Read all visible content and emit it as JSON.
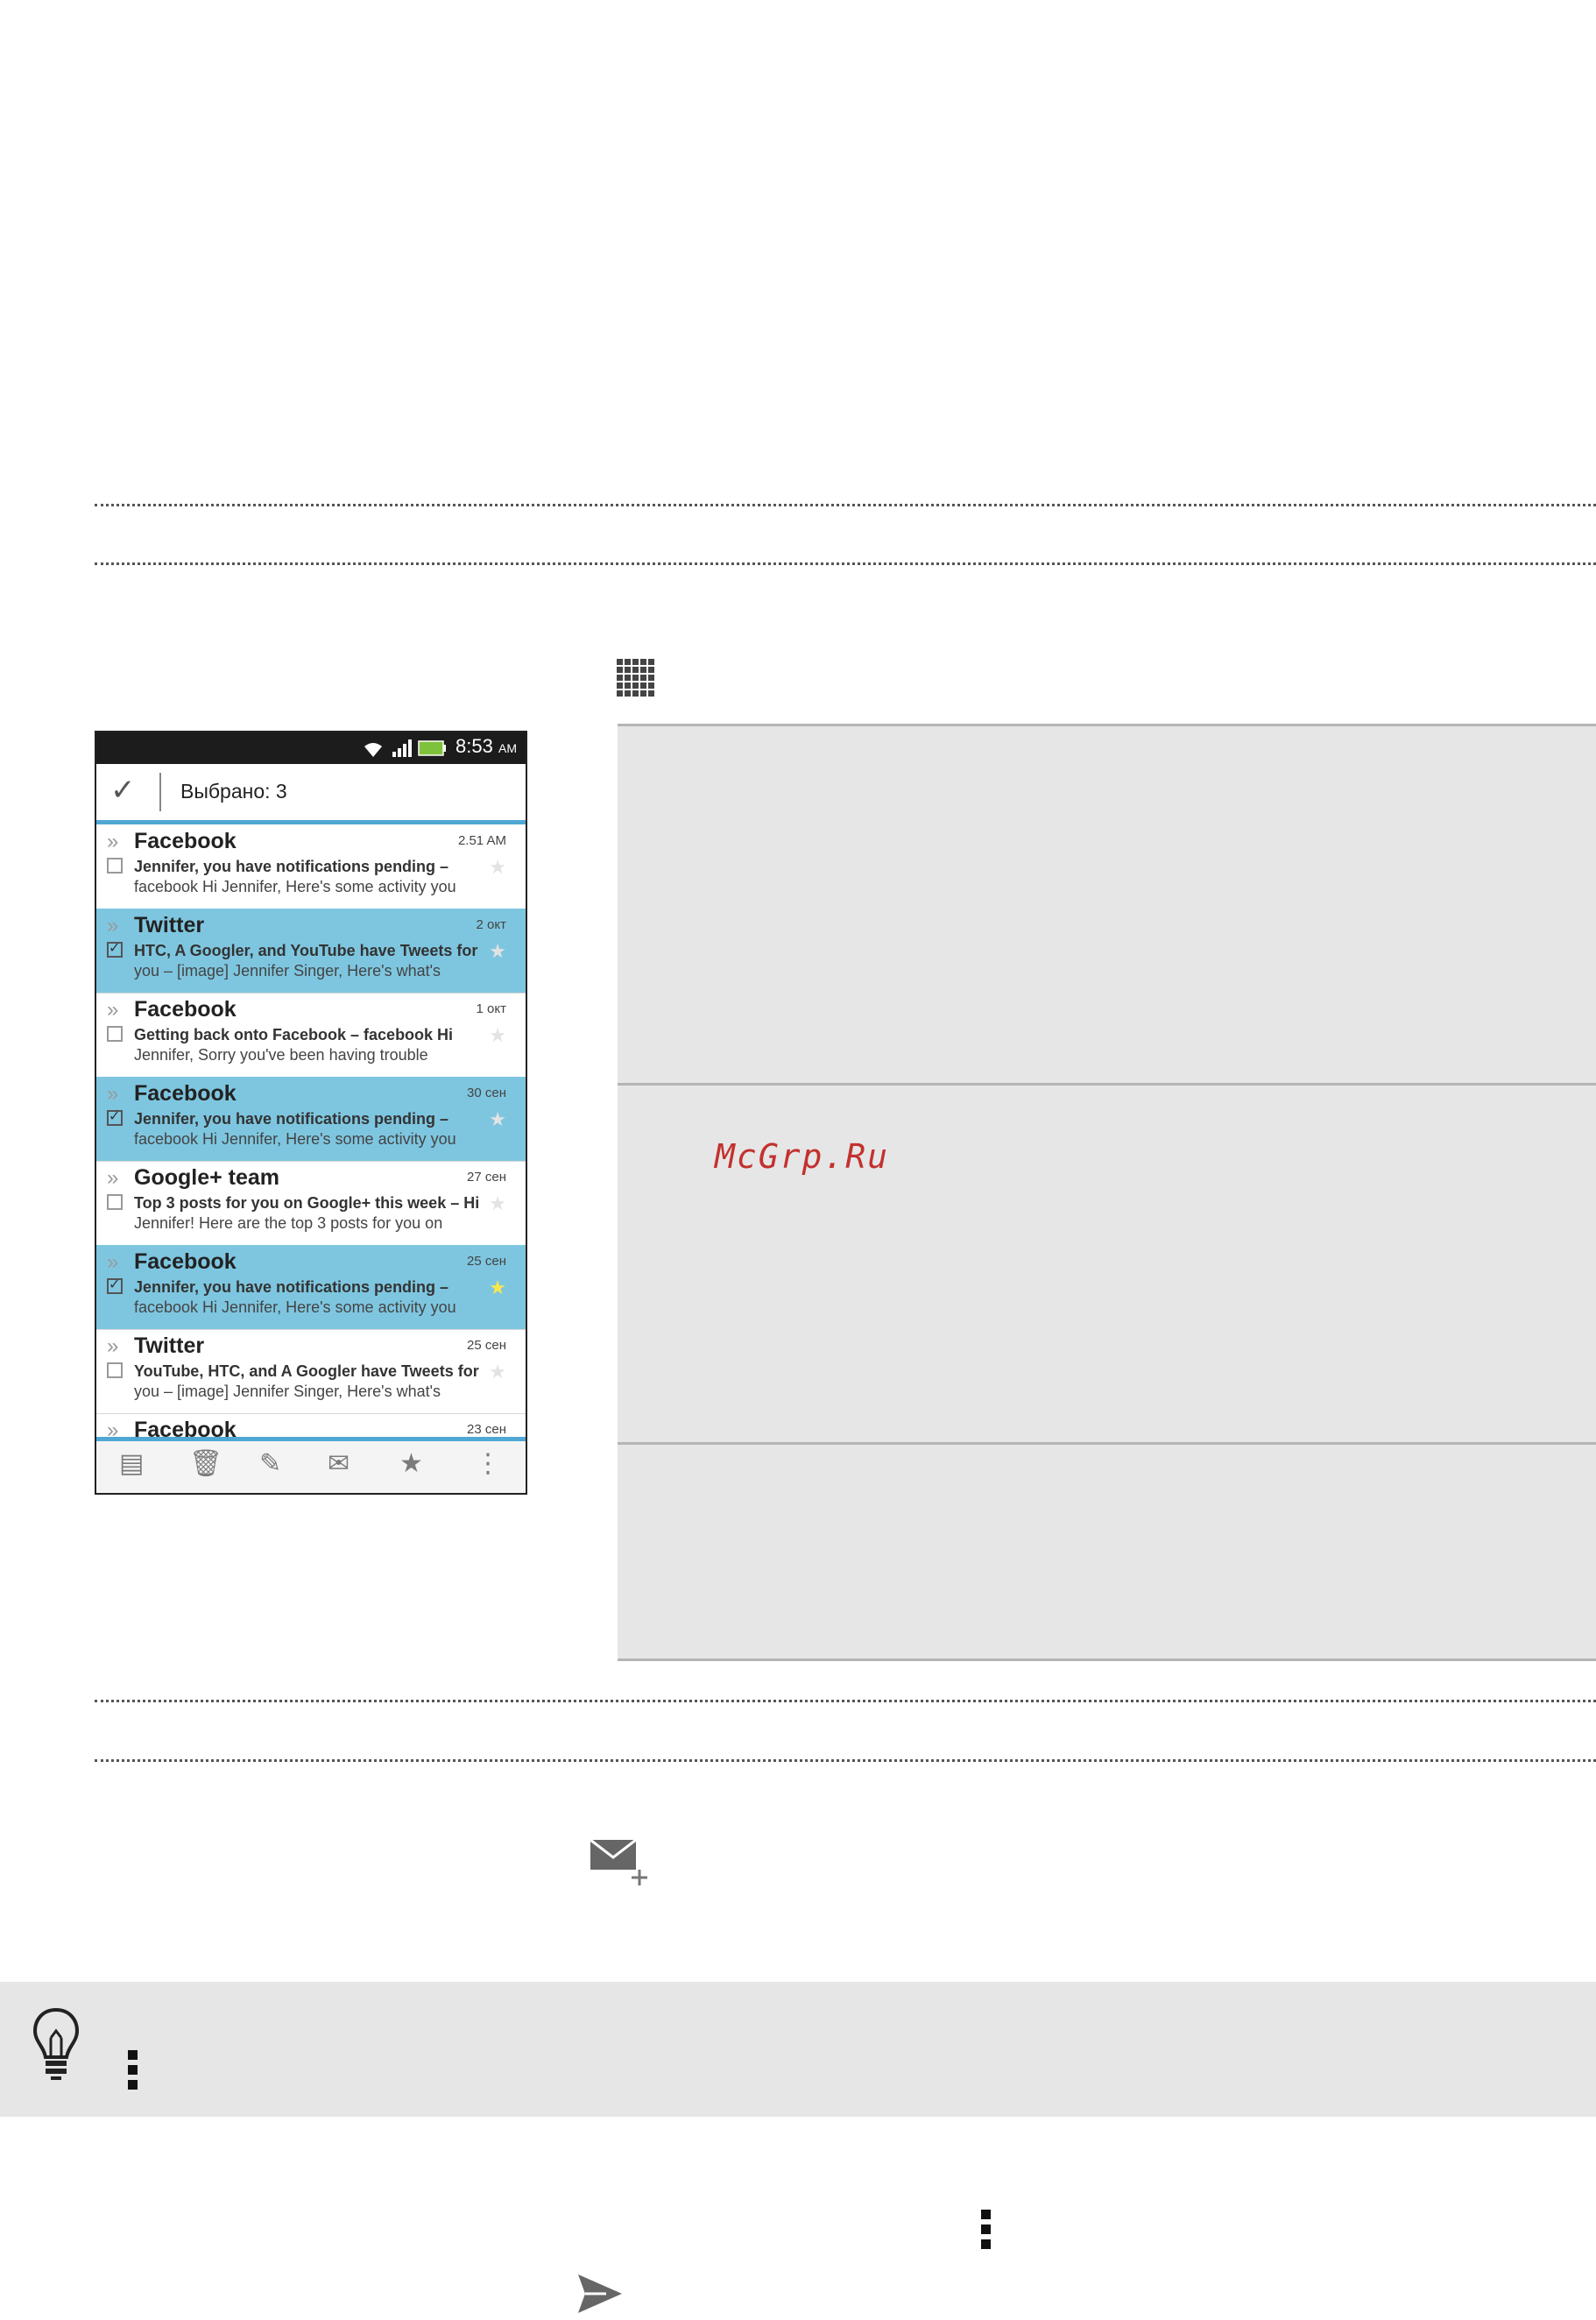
{
  "phone": {
    "status_time": "8:53",
    "status_ampm": "AM",
    "selection_label": "Выбрано: 3",
    "emails": [
      {
        "sender": "Facebook",
        "date": "2.51 AM",
        "line1": "Jennifer, you have notifications pending –",
        "line2": "facebook Hi Jennifer, Here's some activity you",
        "selected": false,
        "starred": false
      },
      {
        "sender": "Twitter",
        "date": "2 окт",
        "line1": "HTC, A Googler, and YouTube have Tweets for",
        "line2": "you – [image] Jennifer Singer, Here's what's",
        "selected": true,
        "starred": false
      },
      {
        "sender": "Facebook",
        "date": "1 окт",
        "line1": "Getting back onto Facebook – facebook Hi",
        "line2": "Jennifer, Sorry you've been having trouble",
        "selected": false,
        "starred": false
      },
      {
        "sender": "Facebook",
        "date": "30 сен",
        "line1": "Jennifer, you have notifications pending –",
        "line2": "facebook Hi Jennifer, Here's some activity you",
        "selected": true,
        "starred": false
      },
      {
        "sender": "Google+ team",
        "date": "27 сен",
        "line1": "Top 3 posts for you on Google+ this week – Hi",
        "line2": "Jennifer! Here are the top 3 posts for you on",
        "selected": false,
        "starred": false
      },
      {
        "sender": "Facebook",
        "date": "25 сен",
        "line1": "Jennifer, you have notifications pending –",
        "line2": "facebook Hi Jennifer, Here's some activity you",
        "selected": true,
        "starred": true
      },
      {
        "sender": "Twitter",
        "date": "25 сен",
        "line1": "YouTube, HTC, and A Googler have Tweets for",
        "line2": "you – [image] Jennifer Singer, Here's what's",
        "selected": false,
        "starred": false
      },
      {
        "sender": "Facebook",
        "date": "23 сен",
        "line1": "",
        "line2": "",
        "selected": false,
        "starred": false
      }
    ]
  },
  "watermark": "McGrp.Ru",
  "icons": {
    "apps_grid": "apps-grid-icon",
    "compose": "compose-mail-icon",
    "tip": "lightbulb-icon",
    "menu": "overflow-menu-icon",
    "send": "send-icon"
  }
}
